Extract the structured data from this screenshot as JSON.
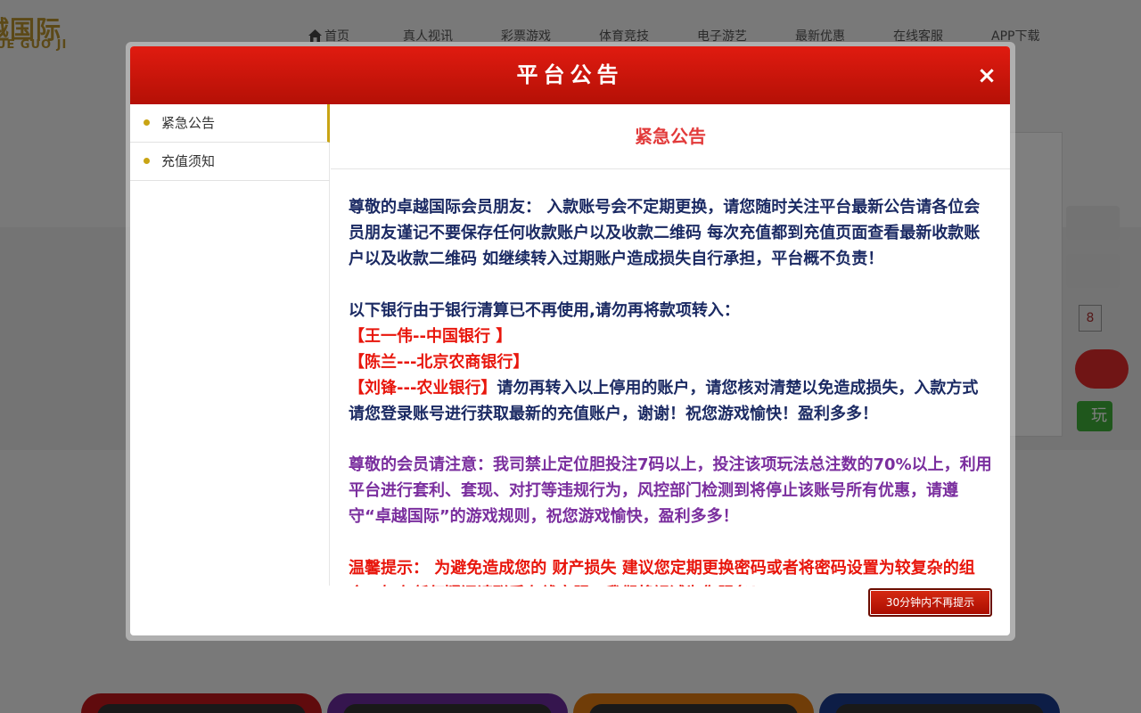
{
  "background": {
    "logo": {
      "text": "越国际",
      "subtext": "JUE GUO JI"
    },
    "nav": [
      {
        "label": "首页",
        "icon": "home-icon"
      },
      {
        "label": "真人视讯"
      },
      {
        "label": "彩票游戏"
      },
      {
        "label": "体育竞技"
      },
      {
        "label": "电子游艺"
      },
      {
        "label": "最新优惠"
      },
      {
        "label": "在线客服"
      },
      {
        "label": "APP下载"
      }
    ],
    "login": {
      "captcha": "8",
      "green_button_text": "玩"
    },
    "tile_colors": [
      "#c0161b",
      "#6a2a9c",
      "#e07a10",
      "#1a3a8c"
    ]
  },
  "modal": {
    "title": "平台公告",
    "close_label": "×",
    "sidebar": [
      {
        "label": "紧急公告",
        "active": true
      },
      {
        "label": "充值须知",
        "active": false
      }
    ],
    "content_title": "紧急公告",
    "paragraphs": {
      "p1": "尊敬的卓越国际会员朋友： 入款账号会不定期更换，请您随时关注平台最新公告请各位会员朋友谨记不要保存任何收款账户以及收款二维码 每次充值都到充值页面查看最新收款账户以及收款二维码 如继续转入过期账户造成损失自行承担，平台概不负责！",
      "p2": "以下银行由于银行清算已不再使用,请勿再将款项转入：",
      "bank1": "【王一伟--中国银行 】",
      "bank2": "【陈兰---北京农商银行】",
      "bank3": "【刘锋---农业银行】",
      "p3_tail": "请勿再转入以上停用的账户，请您核对清楚以免造成损失，入款方式请您登录账号进行获取最新的充值账户，谢谢！祝您游戏愉快！盈利多多！",
      "p4": "尊敬的会员请注意：我司禁止定位胆投注7码以上，投注该项玩法总注数的70%以上，利用平台进行套利、套现、对打等违规行为，风控部门检测到将停止该账号所有优惠，请遵守“卓越国际”的游戏规则，祝您游戏愉快，盈利多多！",
      "p5": "温馨提示： 为避免造成您的 财产损失 建议您定期更换密码或者将密码设置为较复杂的组合，如有任何疑问请联系在线客服，我们将竭诚为您服务！"
    },
    "dismiss_button": "30分钟内不再提示"
  }
}
